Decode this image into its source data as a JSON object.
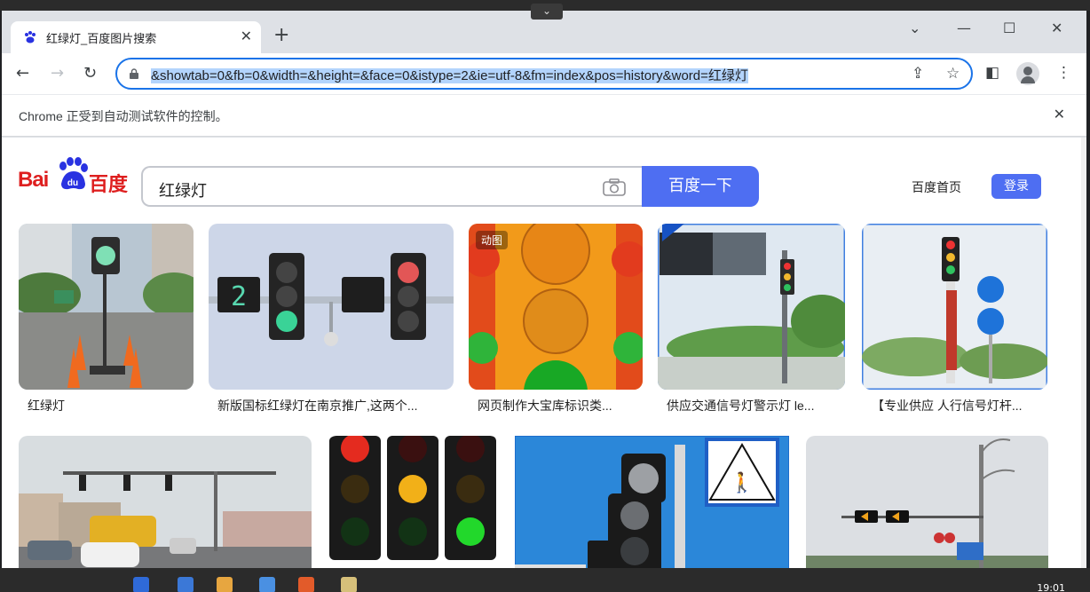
{
  "browser": {
    "tab_title": "红绿灯_百度图片搜索",
    "tab_close": "✕",
    "new_tab": "+",
    "url": "&showtab=0&fb=0&width=&height=&face=0&istype=2&ie=utf-8&fm=index&pos=history&word=红绿灯",
    "infobar_text": "Chrome 正受到自动测试软件的控制。",
    "infobar_close": "✕"
  },
  "baidu": {
    "logo_bai": "Bai",
    "logo_du": "du",
    "logo_cn": "百度",
    "search_query": "红绿灯",
    "search_button": "百度一下",
    "home_link": "百度首页",
    "login_button": "登录"
  },
  "results": [
    {
      "caption": "红绿灯"
    },
    {
      "caption": "新版国标红绿灯在南京推广,这两个..."
    },
    {
      "caption": "网页制作大宝库标识类...",
      "badge": "动图"
    },
    {
      "caption": "供应交通信号灯警示灯 le..."
    },
    {
      "caption": "【专业供应 人行信号灯杆..."
    },
    {
      "caption": ""
    },
    {
      "caption": ""
    },
    {
      "caption": ""
    },
    {
      "caption": ""
    }
  ],
  "taskbar": {
    "clock": "19:01"
  },
  "colors": {
    "accent": "#4e6ef2",
    "baidu_red": "#de1f1f",
    "chrome_focus": "#1a73e8"
  }
}
